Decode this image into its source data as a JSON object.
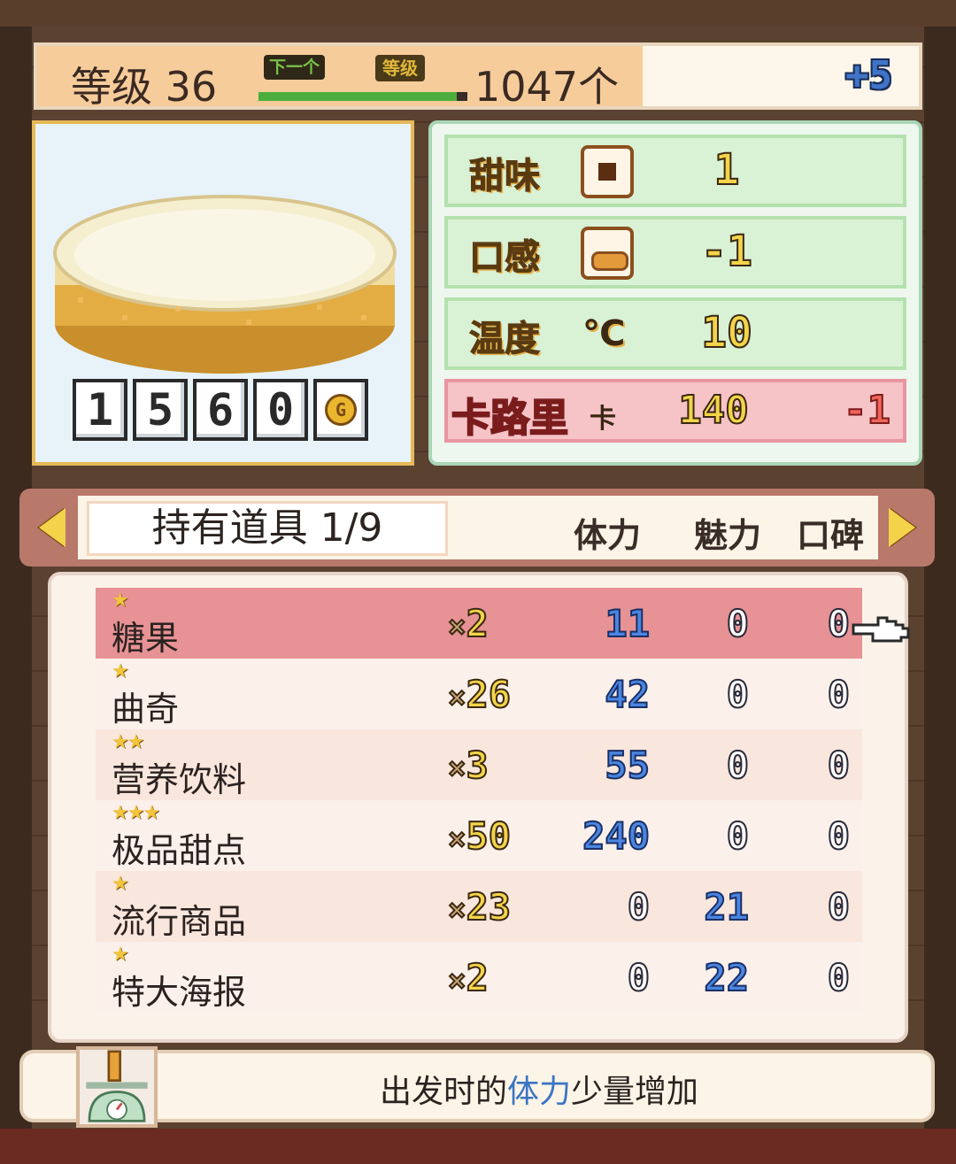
{
  "level": {
    "label": "等级 36",
    "next_tag": "下一个",
    "level_tag": "等级",
    "progress": 0.95,
    "count": "1047个",
    "bonus": "+5"
  },
  "item": {
    "price_digits": [
      "1",
      "5",
      "6",
      "0"
    ],
    "currency_icon": "G"
  },
  "stats": {
    "sweetness": {
      "label": "甜味",
      "icon": "square-icon",
      "value": "1"
    },
    "texture": {
      "label": "口感",
      "icon": "bread-icon",
      "value": "-1"
    },
    "temperature": {
      "label": "温度",
      "icon": "℃",
      "value": "10"
    },
    "calories": {
      "label": "卡路里",
      "unit": "卡",
      "value": "140",
      "delta": "-1"
    }
  },
  "tabs": {
    "title": "持有道具 1/9",
    "col_stamina": "体力",
    "col_charm": "魅力",
    "col_reputation": "口碑"
  },
  "items": [
    {
      "stars": "★",
      "name": "糖果",
      "qty": "2",
      "stamina": "11",
      "charm": "0",
      "rep": "0"
    },
    {
      "stars": "★",
      "name": "曲奇",
      "qty": "26",
      "stamina": "42",
      "charm": "0",
      "rep": "0"
    },
    {
      "stars": "★★",
      "name": "营养饮料",
      "qty": "3",
      "stamina": "55",
      "charm": "0",
      "rep": "0"
    },
    {
      "stars": "★★★",
      "name": "极品甜点",
      "qty": "50",
      "stamina": "240",
      "charm": "0",
      "rep": "0"
    },
    {
      "stars": "★",
      "name": "流行商品",
      "qty": "23",
      "stamina": "0",
      "charm": "21",
      "rep": "0"
    },
    {
      "stars": "★",
      "name": "特大海报",
      "qty": "2",
      "stamina": "0",
      "charm": "22",
      "rep": "0"
    }
  ],
  "description": {
    "prefix": "出发时的",
    "highlight": "体力",
    "suffix": "少量增加"
  },
  "colors": {
    "selected_row": "#e79295",
    "stat_blue": "#4a86e0",
    "accent_gold": "#f3d44a"
  }
}
